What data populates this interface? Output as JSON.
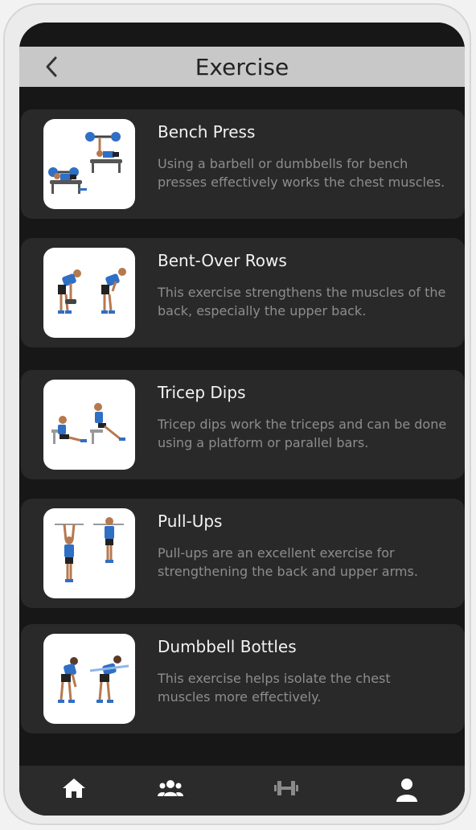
{
  "header": {
    "title": "Exercise",
    "back_icon": "chevron-left-icon"
  },
  "exercises": [
    {
      "name": "Bench Press",
      "description": "Using a barbell or dumbbells for bench presses effectively works the chest muscles.",
      "image": "bench-press-illustration"
    },
    {
      "name": "Bent-Over Rows",
      "description": "This exercise strengthens the muscles of the back, especially the upper back.",
      "image": "bent-over-rows-illustration"
    },
    {
      "name": "Tricep Dips",
      "description": "Tricep dips work the triceps and can be done using a platform or parallel bars.",
      "image": "tricep-dips-illustration"
    },
    {
      "name": "Pull-Ups",
      "description": "Pull-ups are an excellent exercise for strengthening the back and upper arms.",
      "image": "pull-ups-illustration"
    },
    {
      "name": "Dumbbell Bottles",
      "description": "This exercise helps isolate the chest muscles more effectively.",
      "image": "dumbbell-bottles-illustration"
    }
  ],
  "bottom_nav": [
    {
      "icon": "home-icon",
      "active": true
    },
    {
      "icon": "group-icon",
      "active": true
    },
    {
      "icon": "dumbbell-icon",
      "active": false
    },
    {
      "icon": "user-icon",
      "active": true
    }
  ],
  "colors": {
    "background": "#171717",
    "card": "#292929",
    "header_bar": "#c8c8c8",
    "accent_blue": "#2f6fc4",
    "text_primary": "#f2f2f2",
    "text_secondary": "#8d8d8d"
  }
}
